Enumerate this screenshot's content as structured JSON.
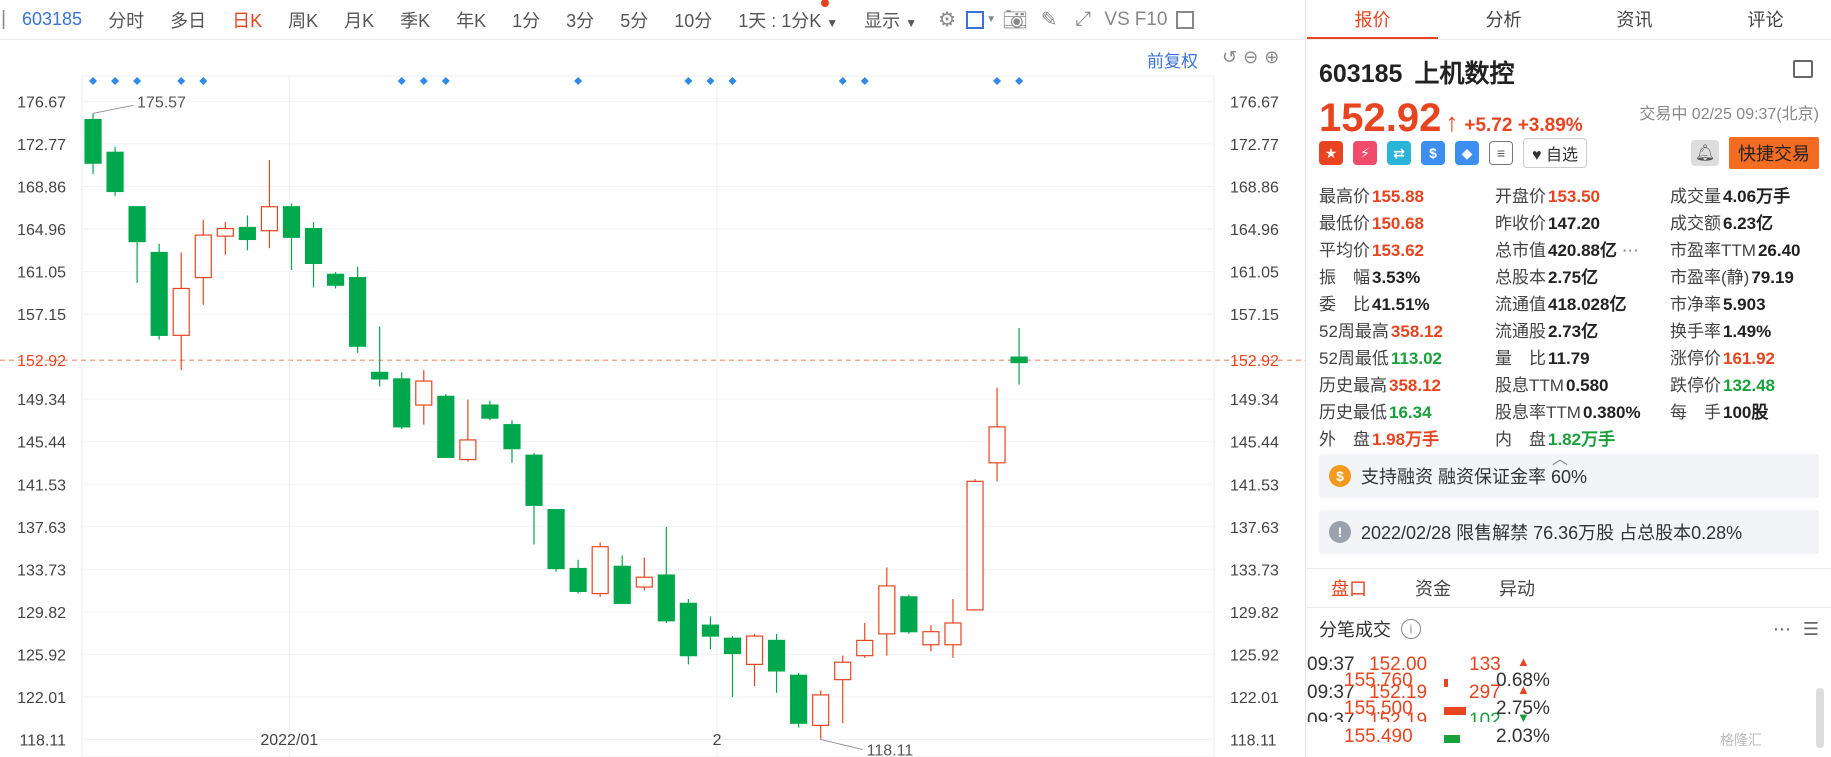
{
  "toolbar": {
    "code": "603185",
    "items": [
      "分时",
      "多日",
      "日K",
      "周K",
      "月K",
      "季K",
      "年K",
      "1分",
      "3分",
      "5分",
      "10分"
    ],
    "active": "日K",
    "interval_select": "1天 : 1分K",
    "display_select": "显示",
    "vs_label": "VS",
    "f10_label": "F10"
  },
  "chart_controls": {
    "restore_label": "前复权"
  },
  "chart_data": {
    "type": "candlestick",
    "y_ticks": [
      176.67,
      172.77,
      168.86,
      164.96,
      161.05,
      157.15,
      152.92,
      149.34,
      145.44,
      141.53,
      137.63,
      133.73,
      129.82,
      125.92,
      122.01,
      118.11
    ],
    "ylim": [
      116.5,
      179.0
    ],
    "x_tick_labels": [
      {
        "label": "2022/01",
        "index": 9.4
      },
      {
        "label": "2",
        "index": 28.8
      }
    ],
    "current_price": 152.92,
    "max_annotation": "175.57",
    "min_annotation": "118.11",
    "markers": [
      0,
      1,
      2,
      4,
      5,
      14,
      15,
      16,
      22,
      27,
      28,
      29,
      34,
      35,
      41,
      42
    ],
    "candles": [
      {
        "o": 175.0,
        "h": 175.57,
        "c": 171.0,
        "l": 170.0
      },
      {
        "o": 172.0,
        "h": 172.5,
        "c": 168.4,
        "l": 168.0
      },
      {
        "o": 167.0,
        "h": 167.0,
        "c": 163.8,
        "l": 160.0
      },
      {
        "o": 162.8,
        "h": 163.6,
        "c": 155.2,
        "l": 154.8
      },
      {
        "o": 155.2,
        "h": 162.8,
        "c": 159.5,
        "l": 152.0
      },
      {
        "o": 160.5,
        "h": 165.8,
        "c": 164.4,
        "l": 158.0
      },
      {
        "o": 164.3,
        "h": 165.6,
        "c": 165.0,
        "l": 162.6
      },
      {
        "o": 165.1,
        "h": 166.2,
        "c": 164.0,
        "l": 163.0
      },
      {
        "o": 164.8,
        "h": 171.3,
        "c": 167.0,
        "l": 163.2
      },
      {
        "o": 167.0,
        "h": 167.3,
        "c": 164.2,
        "l": 161.2
      },
      {
        "o": 165.0,
        "h": 165.6,
        "c": 161.8,
        "l": 159.6
      },
      {
        "o": 160.8,
        "h": 161.0,
        "c": 159.8,
        "l": 159.5
      },
      {
        "o": 160.5,
        "h": 161.5,
        "c": 154.2,
        "l": 153.6
      },
      {
        "o": 151.8,
        "h": 156.0,
        "c": 151.2,
        "l": 150.5
      },
      {
        "o": 151.2,
        "h": 151.8,
        "c": 146.8,
        "l": 146.6
      },
      {
        "o": 148.8,
        "h": 152.0,
        "c": 151.0,
        "l": 147.0
      },
      {
        "o": 149.6,
        "h": 149.8,
        "c": 144.0,
        "l": 144.0
      },
      {
        "o": 143.8,
        "h": 149.3,
        "c": 145.6,
        "l": 143.6
      },
      {
        "o": 148.8,
        "h": 149.2,
        "c": 147.6,
        "l": 147.4
      },
      {
        "o": 147.0,
        "h": 147.4,
        "c": 144.8,
        "l": 143.5
      },
      {
        "o": 144.2,
        "h": 144.4,
        "c": 139.6,
        "l": 136.0
      },
      {
        "o": 139.2,
        "h": 139.2,
        "c": 133.8,
        "l": 133.5
      },
      {
        "o": 133.8,
        "h": 134.6,
        "c": 131.7,
        "l": 131.5
      },
      {
        "o": 131.5,
        "h": 136.2,
        "c": 135.8,
        "l": 131.2
      },
      {
        "o": 134.0,
        "h": 135.0,
        "c": 130.6,
        "l": 130.6
      },
      {
        "o": 132.1,
        "h": 134.8,
        "c": 133.0,
        "l": 131.8
      },
      {
        "o": 133.2,
        "h": 137.6,
        "c": 129.0,
        "l": 128.8
      },
      {
        "o": 130.6,
        "h": 131.0,
        "c": 125.8,
        "l": 125.0
      },
      {
        "o": 128.6,
        "h": 129.4,
        "c": 127.6,
        "l": 126.4
      },
      {
        "o": 127.4,
        "h": 127.6,
        "c": 126.0,
        "l": 122.0
      },
      {
        "o": 125.0,
        "h": 127.8,
        "c": 127.6,
        "l": 123.0
      },
      {
        "o": 127.2,
        "h": 127.8,
        "c": 124.4,
        "l": 122.4
      },
      {
        "o": 124.0,
        "h": 124.2,
        "c": 119.6,
        "l": 119.2
      },
      {
        "o": 119.4,
        "h": 122.6,
        "c": 122.2,
        "l": 118.11
      },
      {
        "o": 123.6,
        "h": 125.8,
        "c": 125.2,
        "l": 119.6
      },
      {
        "o": 125.8,
        "h": 128.8,
        "c": 127.2,
        "l": 125.6
      },
      {
        "o": 127.8,
        "h": 133.9,
        "c": 132.2,
        "l": 125.8
      },
      {
        "o": 131.2,
        "h": 131.4,
        "c": 128.0,
        "l": 127.8
      },
      {
        "o": 126.8,
        "h": 128.6,
        "c": 128.0,
        "l": 126.2
      },
      {
        "o": 126.8,
        "h": 131.0,
        "c": 128.8,
        "l": 125.6
      },
      {
        "o": 130.0,
        "h": 142.0,
        "c": 141.8,
        "l": 130.0
      },
      {
        "o": 143.5,
        "h": 150.4,
        "c": 146.8,
        "l": 141.8
      },
      {
        "o": 153.2,
        "h": 155.88,
        "c": 152.7,
        "l": 150.68
      }
    ]
  },
  "tabs": [
    "报价",
    "分析",
    "资讯",
    "评论"
  ],
  "stock": {
    "code": "603185",
    "name": "上机数控",
    "price": "152.92",
    "change": "+5.72 +3.89%",
    "status": "交易中 02/25 09:37(北京)",
    "watch_label": "自选",
    "quick_trade_label": "快捷交易"
  },
  "stats": [
    {
      "label": "最高价",
      "value": "155.88",
      "color": "red"
    },
    {
      "label": "开盘价",
      "value": "153.50",
      "color": "red"
    },
    {
      "label": "成交量",
      "value": "4.06万手",
      "color": ""
    },
    {
      "label": "最低价",
      "value": "150.68",
      "color": "red"
    },
    {
      "label": "昨收价",
      "value": "147.20",
      "color": ""
    },
    {
      "label": "成交额",
      "value": "6.23亿",
      "color": ""
    },
    {
      "label": "平均价",
      "value": "153.62",
      "color": "red"
    },
    {
      "label": "总市值",
      "value": "420.88亿",
      "color": ""
    },
    {
      "label": "市盈率TTM",
      "value": "26.40",
      "color": ""
    },
    {
      "label": "振　幅",
      "value": "3.53%",
      "color": ""
    },
    {
      "label": "总股本",
      "value": "2.75亿",
      "color": ""
    },
    {
      "label": "市盈率(静)",
      "value": "79.19",
      "color": ""
    },
    {
      "label": "委　比",
      "value": "41.51%",
      "color": ""
    },
    {
      "label": "流通值",
      "value": "418.028亿",
      "color": ""
    },
    {
      "label": "市净率",
      "value": "5.903",
      "color": ""
    },
    {
      "label": "52周最高",
      "value": "358.12",
      "color": "red"
    },
    {
      "label": "流通股",
      "value": "2.73亿",
      "color": ""
    },
    {
      "label": "换手率",
      "value": "1.49%",
      "color": ""
    },
    {
      "label": "52周最低",
      "value": "113.02",
      "color": "green"
    },
    {
      "label": "量　比",
      "value": "11.79",
      "color": ""
    },
    {
      "label": "涨停价",
      "value": "161.92",
      "color": "red"
    },
    {
      "label": "历史最高",
      "value": "358.12",
      "color": "red"
    },
    {
      "label": "股息TTM",
      "value": "0.580",
      "color": ""
    },
    {
      "label": "跌停价",
      "value": "132.48",
      "color": "green"
    },
    {
      "label": "历史最低",
      "value": "16.34",
      "color": "green"
    },
    {
      "label": "股息率TTM",
      "value": "0.380%",
      "color": ""
    },
    {
      "label": "每　手",
      "value": "100股",
      "color": ""
    },
    {
      "label": "外　盘",
      "value": "1.98万手",
      "color": "red"
    },
    {
      "label": "内　盘",
      "value": "1.82万手",
      "color": "green"
    }
  ],
  "notices": [
    {
      "icon": "$",
      "text": "支持融资 融资保证金率 60%"
    },
    {
      "icon": "!",
      "text": "2022/02/28 限售解禁 76.36万股 占总股本0.28%"
    }
  ],
  "sub_tabs": [
    "盘口",
    "资金",
    "异动"
  ],
  "trades_title": "分笔成交",
  "trades": [
    {
      "time": "09:37",
      "price": "152.00",
      "vol": "133",
      "dir": "up"
    },
    {
      "time": "09:37",
      "price": "152.19",
      "vol": "297",
      "dir": "up"
    },
    {
      "time": "09:37",
      "price": "152.19",
      "vol": "102",
      "dir": "down"
    }
  ],
  "book": [
    {
      "price": "155.760",
      "pct": "0.68%",
      "bar": 0.1,
      "color": "#e8441f"
    },
    {
      "price": "155.500",
      "pct": "2.75%",
      "bar": 0.55,
      "color": "#e8441f"
    },
    {
      "price": "155.490",
      "pct": "2.03%",
      "bar": 0.4,
      "color": "#1aa03a"
    }
  ],
  "colors": {
    "up": "#e8441f",
    "down": "#00a84d",
    "accent": "#3973d6"
  },
  "watermark": "格隆汇"
}
